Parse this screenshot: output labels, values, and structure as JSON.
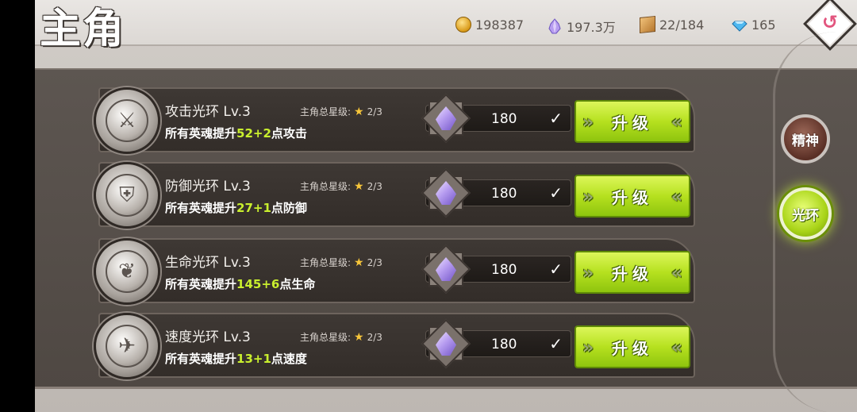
{
  "header": {
    "title": "主角",
    "gold": "198387",
    "crystal": "197.3万",
    "bag": "22/184",
    "diamond": "165"
  },
  "icons": {
    "gold": "coin-icon",
    "crystal": "crystal-icon",
    "bag": "box-icon",
    "diamond": "diamond-icon",
    "back": "back-arrow-icon"
  },
  "tabs": {
    "spirit": "精神",
    "aura": "光环",
    "active": "aura"
  },
  "rows": [
    {
      "name": "攻击光环 Lv.3",
      "desc_prefix": "所有英魂提升",
      "desc_value": "52+2",
      "desc_suffix": "点攻击",
      "stars_label": "主角总星级:",
      "stars": "2/3",
      "cost": "180",
      "button": "升级",
      "icon": "sword-crest-icon"
    },
    {
      "name": "防御光环 Lv.3",
      "desc_prefix": "所有英魂提升",
      "desc_value": "27+1",
      "desc_suffix": "点防御",
      "stars_label": "主角总星级:",
      "stars": "2/3",
      "cost": "180",
      "button": "升级",
      "icon": "shield-icon"
    },
    {
      "name": "生命光环 Lv.3",
      "desc_prefix": "所有英魂提升",
      "desc_value": "145+6",
      "desc_suffix": "点生命",
      "stars_label": "主角总星级:",
      "stars": "2/3",
      "cost": "180",
      "button": "升级",
      "icon": "heart-crest-icon"
    },
    {
      "name": "速度光环 Lv.3",
      "desc_prefix": "所有英魂提升",
      "desc_value": "13+1",
      "desc_suffix": "点速度",
      "stars_label": "主角总星级:",
      "stars": "2/3",
      "cost": "180",
      "button": "升级",
      "icon": "wing-crest-icon"
    }
  ],
  "colors": {
    "highlight": "#c9ef2e",
    "button": "#b6e11f",
    "star": "#f7c63a"
  }
}
